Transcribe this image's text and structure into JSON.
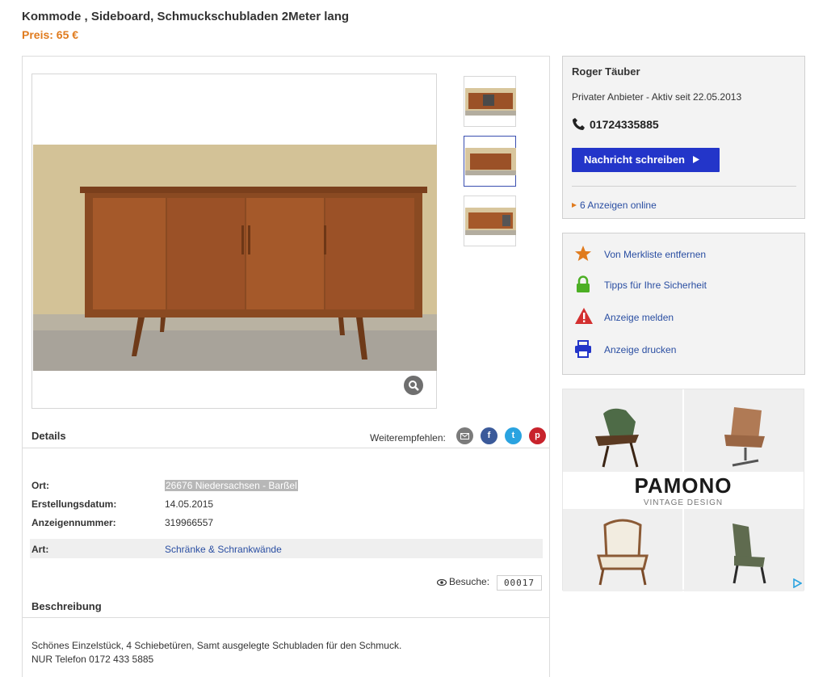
{
  "listing": {
    "title": "Kommode , Sideboard, Schmuckschubladen 2Meter lang",
    "price": "Preis: 65 €"
  },
  "details": {
    "heading": "Details",
    "share_label": "Weiterempfehlen:",
    "share_icons": [
      "email-icon",
      "facebook-icon",
      "twitter-icon",
      "pinterest-icon"
    ],
    "rows": [
      {
        "label": "Ort:",
        "value": "26676 Niedersachsen - Barßel"
      },
      {
        "label": "Erstellungsdatum:",
        "value": "14.05.2015"
      },
      {
        "label": "Anzeigennummer:",
        "value": "319966557"
      },
      {
        "label": "Art:",
        "value": "Schränke & Schrankwände"
      }
    ],
    "visits_label": "Besuche:",
    "visits_count": "00017"
  },
  "description": {
    "heading": "Beschreibung",
    "line1": "Schönes Einzelstück, 4 Schiebetüren, Samt ausgelegte Schubladen für den Schmuck.",
    "line2": "NUR Telefon 0172 433 5885"
  },
  "seller": {
    "name": "Roger Täuber",
    "info": "Privater Anbieter - Aktiv seit 22.05.2013",
    "phone": "01724335885",
    "message_button": "Nachricht schreiben",
    "ads_online": "6 Anzeigen online"
  },
  "actions": [
    {
      "label": "Von Merkliste entfernen",
      "icon": "star-icon"
    },
    {
      "label": "Tipps für Ihre Sicherheit",
      "icon": "lock-icon"
    },
    {
      "label": "Anzeige melden",
      "icon": "warning-icon"
    },
    {
      "label": "Anzeige drucken",
      "icon": "printer-icon"
    }
  ],
  "ad": {
    "brand": "PAMONO",
    "tagline": "VINTAGE DESIGN"
  },
  "colors": {
    "accent": "#e07b1e",
    "button": "#2335c9",
    "link": "#2a4ea2"
  }
}
